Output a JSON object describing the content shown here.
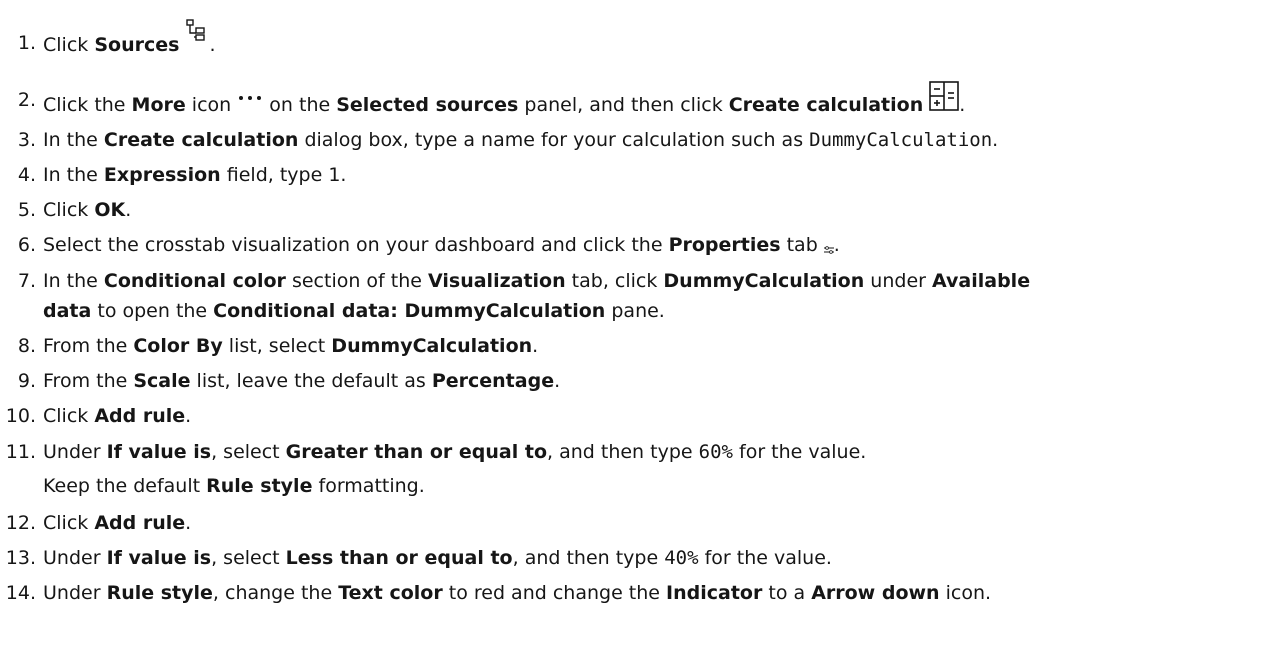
{
  "steps": [
    {
      "num": "1.",
      "t0": "Click ",
      "b0": "Sources",
      "t1": "."
    },
    {
      "num": "2.",
      "t0": "Click the ",
      "b0": "More",
      "t1": " icon ",
      "t2": " on the ",
      "b1": "Selected sources",
      "t3": " panel, and then click ",
      "b2": "Create calculation",
      "t4": "."
    },
    {
      "num": "3.",
      "t0": "In the ",
      "b0": "Create calculation",
      "t1": " dialog box, type a name for your calculation such as ",
      "code": "DummyCalculation",
      "t2": "."
    },
    {
      "num": "4.",
      "t0": "In the ",
      "b0": "Expression",
      "t1": " field, type 1."
    },
    {
      "num": "5.",
      "t0": "Click ",
      "b0": "OK",
      "t1": "."
    },
    {
      "num": "6.",
      "t0": "Select the crosstab visualization on your dashboard and click the ",
      "b0": "Properties",
      "t1": " tab ",
      "t2": "."
    },
    {
      "num": "7.",
      "t0": "In the ",
      "b0": "Conditional color",
      "t1": " section of the ",
      "b1": "Visualization",
      "t2": " tab, click ",
      "b2": "DummyCalculation",
      "t3": " under ",
      "b3": "Available",
      "b4": "data",
      "t4": " to open the ",
      "b5": "Conditional data: DummyCalculation",
      "t5": " pane."
    },
    {
      "num": "8.",
      "t0": "From the ",
      "b0": "Color By",
      "t1": " list, select ",
      "b1": "DummyCalculation",
      "t2": "."
    },
    {
      "num": "9.",
      "t0": "From the ",
      "b0": "Scale",
      "t1": " list, leave the default as ",
      "b1": "Percentage",
      "t2": "."
    },
    {
      "num": "10.",
      "t0": "Click ",
      "b0": "Add rule",
      "t1": "."
    },
    {
      "num": "11.",
      "t0": "Under ",
      "b0": "If value is",
      "t1": ", select ",
      "b1": "Greater than or equal to",
      "t2": ", and then type ",
      "code": "60%",
      "t3": " for the value.",
      "sub0": "Keep the default ",
      "subb": "Rule style",
      "sub1": " formatting."
    },
    {
      "num": "12.",
      "t0": "Click ",
      "b0": "Add rule",
      "t1": "."
    },
    {
      "num": "13.",
      "t0": "Under ",
      "b0": "If value is",
      "t1": ", select ",
      "b1": "Less than or equal to",
      "t2": ", and then type ",
      "code": "40%",
      "t3": " for the value."
    },
    {
      "num": "14.",
      "t0": "Under ",
      "b0": "Rule style",
      "t1": ", change the ",
      "b1": "Text color",
      "t2": " to red and change the ",
      "b2": "Indicator",
      "t3": " to a ",
      "b3": "Arrow down",
      "t4": " icon."
    }
  ],
  "icons": {
    "sources": "sources-tree-icon",
    "more": "more-ellipsis-icon",
    "create_calculation": "create-calculation-icon",
    "properties": "properties-icon"
  }
}
